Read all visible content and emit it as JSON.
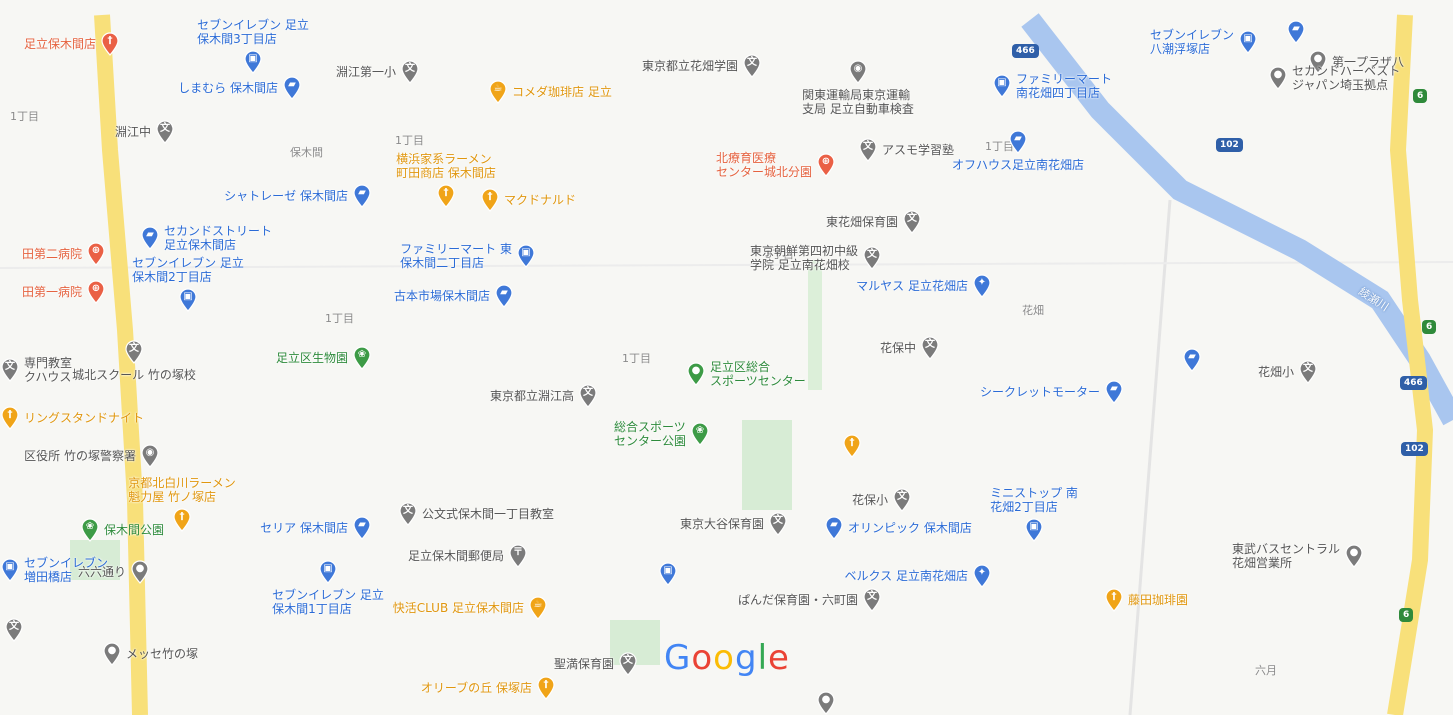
{
  "map": {
    "logo_letters": [
      {
        "ch": "G",
        "color": "#4285F4"
      },
      {
        "ch": "o",
        "color": "#EA4335"
      },
      {
        "ch": "o",
        "color": "#FBBC05"
      },
      {
        "ch": "g",
        "color": "#4285F4"
      },
      {
        "ch": "l",
        "color": "#34A853"
      },
      {
        "ch": "e",
        "color": "#EA4335"
      }
    ],
    "road_shields": [
      "466",
      "466",
      "102",
      "102",
      "6",
      "6",
      "6"
    ],
    "road_names": [
      "綾瀬川"
    ],
    "area_labels": [
      "1丁目",
      "1丁目",
      "1丁目",
      "1丁目",
      "3丁目",
      "1丁目",
      "保木間",
      "花畑",
      "六月"
    ],
    "pois": [
      {
        "name": "足立保木間店",
        "category": "restaurant",
        "color": "red"
      },
      {
        "name": "セブンイレブン 足立\n保木間3丁目店",
        "category": "convenience",
        "color": "blue"
      },
      {
        "name": "しまむら 保木間店",
        "category": "shopping",
        "color": "blue"
      },
      {
        "name": "淵江第一小",
        "category": "school",
        "color": "gray"
      },
      {
        "name": "淵江中",
        "category": "school",
        "color": "gray"
      },
      {
        "name": "コメダ珈琲店 足立",
        "category": "cafe",
        "color": "orange"
      },
      {
        "name": "東京都立花畑学園",
        "category": "school",
        "color": "gray"
      },
      {
        "name": "関東運輸局東京運輸\n支局 足立自動車検査",
        "category": "government",
        "color": "gray"
      },
      {
        "name": "ファミリーマート\n南花畑四丁目店",
        "category": "convenience",
        "color": "blue"
      },
      {
        "name": "セブンイレブン\n八潮浮塚店",
        "category": "convenience",
        "color": "blue"
      },
      {
        "name": "第一プラザ八",
        "category": "place",
        "color": "gray"
      },
      {
        "name": "セカンドハーベスト\nジャパン埼玉拠点",
        "category": "place",
        "color": "gray"
      },
      {
        "name": "横浜家系ラーメン\n町田商店 保木間店",
        "category": "restaurant",
        "color": "orange"
      },
      {
        "name": "北療育医療\nセンター城北分園",
        "category": "hospital",
        "color": "red"
      },
      {
        "name": "アスモ学習塾",
        "category": "school",
        "color": "gray"
      },
      {
        "name": "オフハウス足立南花畑店",
        "category": "shopping",
        "color": "blue"
      },
      {
        "name": "シャトレーゼ 保木間店",
        "category": "shopping",
        "color": "blue"
      },
      {
        "name": "マクドナルド",
        "category": "restaurant",
        "color": "orange"
      },
      {
        "name": "東花畑保育園",
        "category": "school",
        "color": "gray"
      },
      {
        "name": "セカンドストリート\n足立保木間店",
        "category": "shopping",
        "color": "blue"
      },
      {
        "name": "ファミリーマート 東\n保木間二丁目店",
        "category": "convenience",
        "color": "blue"
      },
      {
        "name": "東京朝鮮第四初中級\n学院 足立南花畑校",
        "category": "school",
        "color": "gray"
      },
      {
        "name": "田第二病院",
        "category": "hospital",
        "color": "red"
      },
      {
        "name": "田第一病院",
        "category": "hospital",
        "color": "red"
      },
      {
        "name": "セブンイレブン 足立\n保木間2丁目店",
        "category": "convenience",
        "color": "blue"
      },
      {
        "name": "古本市場保木間店",
        "category": "shopping",
        "color": "blue"
      },
      {
        "name": "マルヤス 足立花畑店",
        "category": "grocery",
        "color": "blue"
      },
      {
        "name": "足立区生物園",
        "category": "park",
        "color": "green"
      },
      {
        "name": "花保中",
        "category": "school",
        "color": "gray"
      },
      {
        "name": "専門教室\nクハウス",
        "category": "school",
        "color": "gray"
      },
      {
        "name": "城北スクール 竹の塚校",
        "category": "school",
        "color": "gray"
      },
      {
        "name": "東京都立淵江高",
        "category": "school",
        "color": "gray"
      },
      {
        "name": "足立区総合\nスポーツセンター",
        "category": "place",
        "color": "green"
      },
      {
        "name": "シークレットモーター",
        "category": "shopping",
        "color": "blue"
      },
      {
        "name": "花畑小",
        "category": "school",
        "color": "gray"
      },
      {
        "name": "リングスタンドナイト",
        "category": "restaurant",
        "color": "orange"
      },
      {
        "name": "総合スポーツ\nセンター公園",
        "category": "park",
        "color": "green"
      },
      {
        "name": "区役所 竹の塚警察署",
        "category": "government",
        "color": "gray"
      },
      {
        "name": "京都北白川ラーメン\n魁力屋 竹ノ塚店",
        "category": "restaurant",
        "color": "orange"
      },
      {
        "name": "保木間公園",
        "category": "park",
        "color": "green"
      },
      {
        "name": "花保小",
        "category": "school",
        "color": "gray"
      },
      {
        "name": "セリア 保木間店",
        "category": "shopping",
        "color": "blue"
      },
      {
        "name": "公文式保木間一丁目教室",
        "category": "school",
        "color": "gray"
      },
      {
        "name": "東京大谷保育園",
        "category": "school",
        "color": "gray"
      },
      {
        "name": "オリンピック 保木間店",
        "category": "shopping",
        "color": "blue"
      },
      {
        "name": "ミニストップ 南\n花畑2丁目店",
        "category": "convenience",
        "color": "blue"
      },
      {
        "name": "東武バスセントラル\n花畑営業所",
        "category": "place",
        "color": "gray"
      },
      {
        "name": "セブンイレブン\n増田橋店",
        "category": "convenience",
        "color": "blue"
      },
      {
        "name": "足立保木間郵便局",
        "category": "post",
        "color": "gray"
      },
      {
        "name": "セブンイレブン 足立\n保木間1丁目店",
        "category": "convenience",
        "color": "blue"
      },
      {
        "name": "快活CLUB 足立保木間店",
        "category": "cafe",
        "color": "orange"
      },
      {
        "name": "ベルクス 足立南花畑店",
        "category": "grocery",
        "color": "blue"
      },
      {
        "name": "ぱんだ保育園・六町園",
        "category": "school",
        "color": "gray"
      },
      {
        "name": "藤田珈琲園",
        "category": "restaurant",
        "color": "orange"
      },
      {
        "name": "メッセ竹の塚",
        "category": "place",
        "color": "gray"
      },
      {
        "name": "聖満保育園",
        "category": "school",
        "color": "gray"
      },
      {
        "name": "オリーブの丘 保塚店",
        "category": "restaurant",
        "color": "orange"
      },
      {
        "name": "六六通り",
        "category": "place",
        "color": "gray"
      },
      {
        "name": "",
        "category": "shopping",
        "color": "blue"
      },
      {
        "name": "",
        "category": "restaurant",
        "color": "orange"
      },
      {
        "name": "",
        "category": "convenience",
        "color": "blue"
      },
      {
        "name": "",
        "category": "shopping",
        "color": "blue"
      },
      {
        "name": "",
        "category": "place",
        "color": "gray"
      },
      {
        "name": "",
        "category": "school",
        "color": "gray"
      }
    ]
  }
}
